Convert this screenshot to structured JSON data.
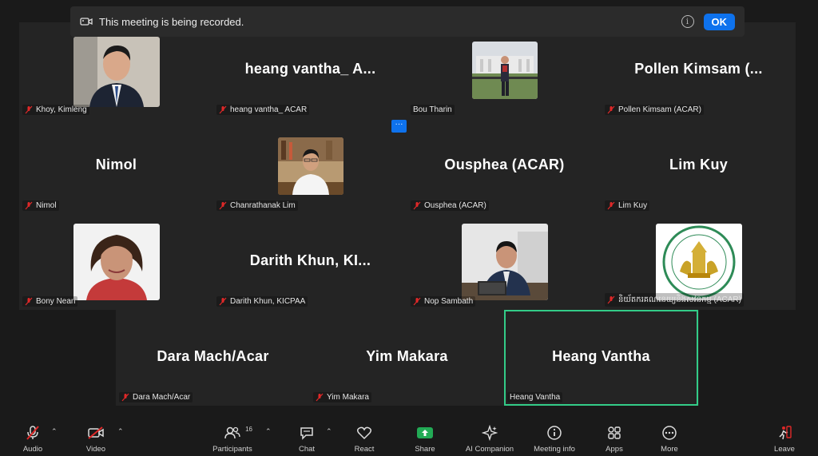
{
  "banner": {
    "text": "This meeting is being recorded.",
    "info_glyph": "i",
    "ok_label": "OK"
  },
  "more_dots": "···",
  "tiles": [
    {
      "label": "Khoy, Kimleng",
      "big": "",
      "muted": true
    },
    {
      "label": "heang vantha_ ACAR",
      "big": "heang vantha_ A...",
      "muted": true
    },
    {
      "label": "Bou Tharin",
      "big": "",
      "muted": false
    },
    {
      "label": "Pollen Kimsam (ACAR)",
      "big": "Pollen Kimsam (...",
      "muted": true
    },
    {
      "label": "Nimol",
      "big": "Nimol",
      "muted": true
    },
    {
      "label": "Chanrathanak Lim",
      "big": "",
      "muted": true
    },
    {
      "label": "Ousphea (ACAR)",
      "big": "Ousphea (ACAR)",
      "muted": true
    },
    {
      "label": "Lim Kuy",
      "big": "Lim Kuy",
      "muted": true
    },
    {
      "label": "Bony Nean",
      "big": "",
      "muted": true
    },
    {
      "label": "Darith Khun, KICPAA",
      "big": "Darith Khun, KI...",
      "muted": true
    },
    {
      "label": "Nop Sambath",
      "big": "",
      "muted": true
    },
    {
      "label": "និយ័តករគណនេយ្យនិងសវនកម្ម (ACAR)",
      "big": "",
      "muted": true
    },
    {
      "label": "Dara Mach/Acar",
      "big": "Dara Mach/Acar",
      "muted": true
    },
    {
      "label": "Yim Makara",
      "big": "Yim Makara",
      "muted": true
    },
    {
      "label": "Heang Vantha",
      "big": "Heang Vantha",
      "muted": false
    }
  ],
  "toolbar": {
    "audio": "Audio",
    "video": "Video",
    "participants": "Participants",
    "participants_count": "16",
    "chat": "Chat",
    "react": "React",
    "share": "Share",
    "ai_companion": "AI Companion",
    "meeting_info": "Meeting info",
    "apps": "Apps",
    "more": "More",
    "leave": "Leave"
  },
  "colors": {
    "accent": "#0e72ed",
    "active_speaker": "#33cc88",
    "share": "#22aa55",
    "leave": "#e02828",
    "mute": "#e02828"
  }
}
